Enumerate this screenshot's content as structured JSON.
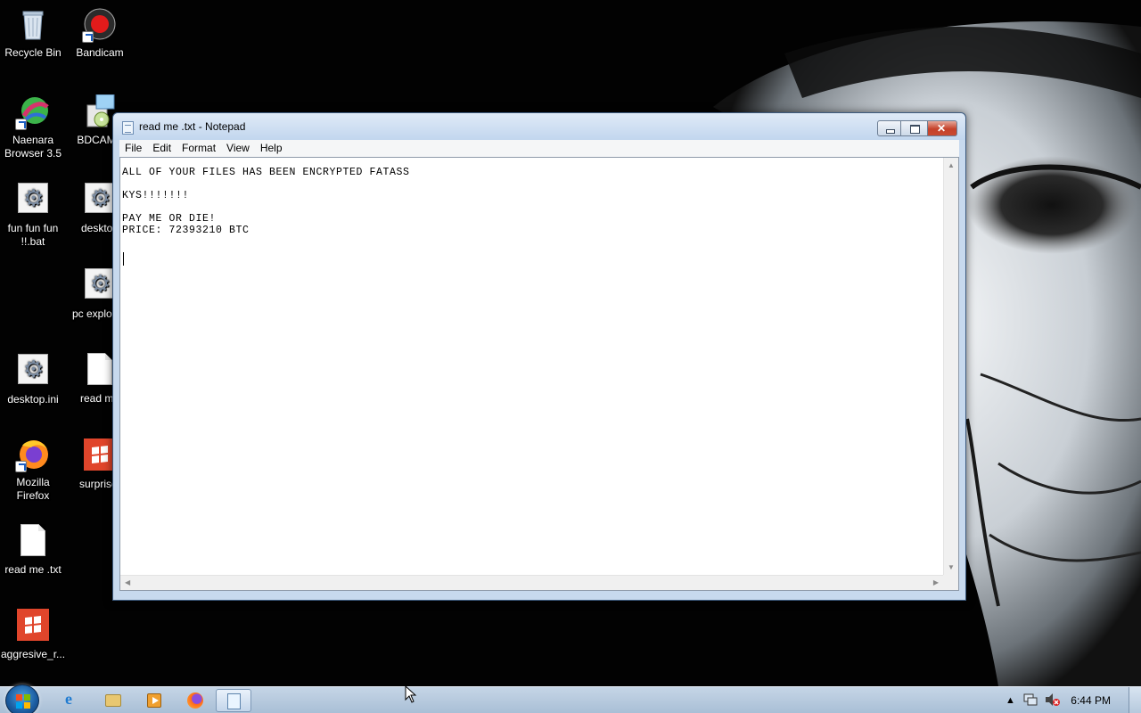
{
  "desktop": {
    "icons": [
      {
        "label": "Recycle Bin"
      },
      {
        "label": "Bandicam"
      },
      {
        "label": "Naenara Browser 3.5"
      },
      {
        "label": "BDCAMS"
      },
      {
        "label": "fun fun fun !!.bat"
      },
      {
        "label": "desktop"
      },
      {
        "label": "pc exploder"
      },
      {
        "label": "desktop.ini"
      },
      {
        "label": "read me"
      },
      {
        "label": "Mozilla Firefox"
      },
      {
        "label": "surprise."
      },
      {
        "label": "read me .txt"
      },
      {
        "label": "aggresive_r..."
      }
    ]
  },
  "notepad": {
    "title": "read me .txt - Notepad",
    "menu": [
      "File",
      "Edit",
      "Format",
      "View",
      "Help"
    ],
    "content": "ALL OF YOUR FILES HAS BEEN ENCRYPTED FATASS\n\nKYS!!!!!!!\n\nPAY ME OR DIE!\nPRICE: 72393210 BTC"
  },
  "taskbar": {
    "pinned": [
      "internet-explorer-icon",
      "explorer-folder-icon",
      "media-player-icon",
      "firefox-icon",
      "notepad-icon"
    ],
    "clock": "6:44 PM"
  },
  "colors": {
    "taskbar": "#b7cadf",
    "close_button": "#c5412a",
    "window_frame": "#c7d9ee"
  }
}
